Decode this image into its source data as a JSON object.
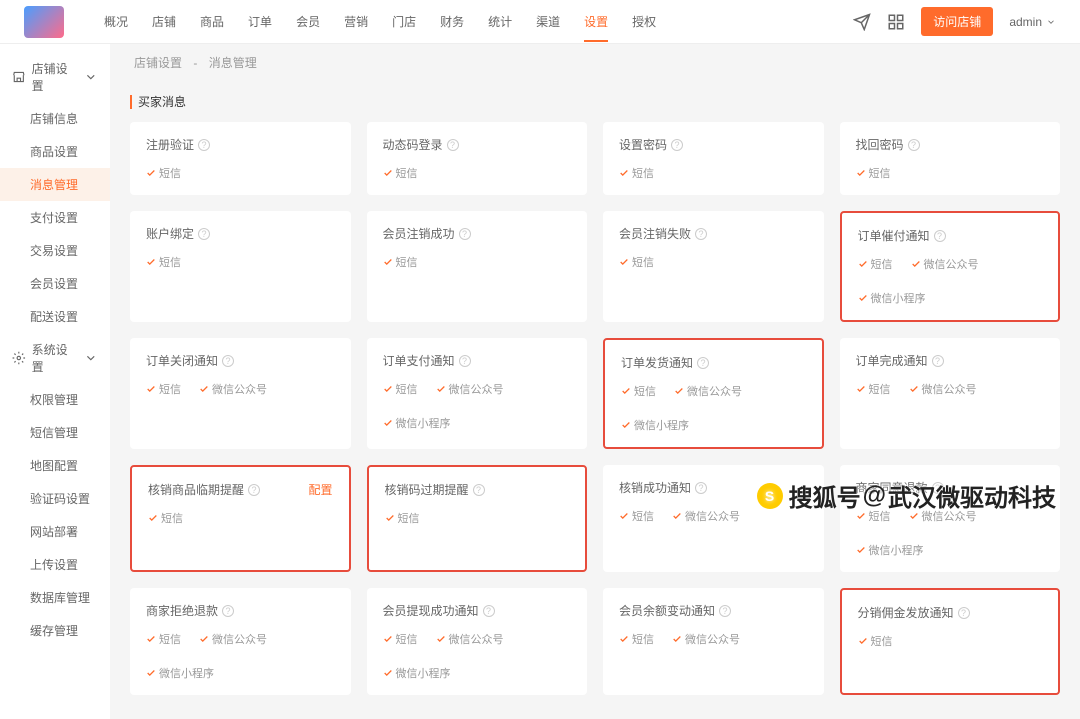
{
  "topnav": {
    "items": [
      "概况",
      "店铺",
      "商品",
      "订单",
      "会员",
      "营销",
      "门店",
      "财务",
      "统计",
      "渠道",
      "设置",
      "授权"
    ],
    "active": 10
  },
  "actions": {
    "visit": "访问店铺",
    "user": "admin"
  },
  "sidebar": {
    "groups": [
      {
        "label": "店铺设置",
        "icon": "shop",
        "open": true,
        "items": [
          "店铺信息",
          "商品设置",
          "消息管理",
          "支付设置",
          "交易设置",
          "会员设置",
          "配送设置"
        ],
        "active": 2
      },
      {
        "label": "系统设置",
        "icon": "gear",
        "open": true,
        "items": [
          "权限管理",
          "短信管理",
          "地图配置",
          "验证码设置",
          "网站部署",
          "上传设置",
          "数据库管理",
          "缓存管理"
        ],
        "active": -1
      }
    ]
  },
  "crumb": [
    "店铺设置",
    "消息管理"
  ],
  "section_title": "买家消息",
  "rows": [
    [
      {
        "title": "注册验证",
        "channels": [
          "短信"
        ]
      },
      {
        "title": "动态码登录",
        "channels": [
          "短信"
        ]
      },
      {
        "title": "设置密码",
        "channels": [
          "短信"
        ]
      },
      {
        "title": "找回密码",
        "channels": [
          "短信"
        ]
      }
    ],
    [
      {
        "title": "账户绑定",
        "channels": [
          "短信"
        ]
      },
      {
        "title": "会员注销成功",
        "channels": [
          "短信"
        ]
      },
      {
        "title": "会员注销失败",
        "channels": [
          "短信"
        ]
      },
      {
        "title": "订单催付通知",
        "channels": [
          "短信",
          "微信公众号",
          "微信小程序"
        ],
        "boxed": true
      }
    ],
    [
      {
        "title": "订单关闭通知",
        "channels": [
          "短信",
          "微信公众号"
        ]
      },
      {
        "title": "订单支付通知",
        "channels": [
          "短信",
          "微信公众号",
          "微信小程序"
        ]
      },
      {
        "title": "订单发货通知",
        "channels": [
          "短信",
          "微信公众号",
          "微信小程序"
        ],
        "boxed": true
      },
      {
        "title": "订单完成通知",
        "channels": [
          "短信",
          "微信公众号"
        ]
      }
    ],
    [
      {
        "title": "核销商品临期提醒",
        "channels": [
          "短信"
        ],
        "boxed": true,
        "config": "配置"
      },
      {
        "title": "核销码过期提醒",
        "channels": [
          "短信"
        ],
        "boxed": true
      },
      {
        "title": "核销成功通知",
        "channels": [
          "短信",
          "微信公众号"
        ]
      },
      {
        "title": "商家同意退款",
        "channels": [
          "短信",
          "微信公众号",
          "微信小程序"
        ]
      }
    ],
    [
      {
        "title": "商家拒绝退款",
        "channels": [
          "短信",
          "微信公众号",
          "微信小程序"
        ]
      },
      {
        "title": "会员提现成功通知",
        "channels": [
          "短信",
          "微信公众号",
          "微信小程序"
        ]
      },
      {
        "title": "会员余额变动通知",
        "channels": [
          "短信",
          "微信公众号"
        ]
      },
      {
        "title": "分销佣金发放通知",
        "channels": [
          "短信"
        ],
        "boxed": true
      }
    ]
  ],
  "watermark": {
    "prefix": "搜狐号",
    "suffix": "武汉微驱动科技"
  }
}
